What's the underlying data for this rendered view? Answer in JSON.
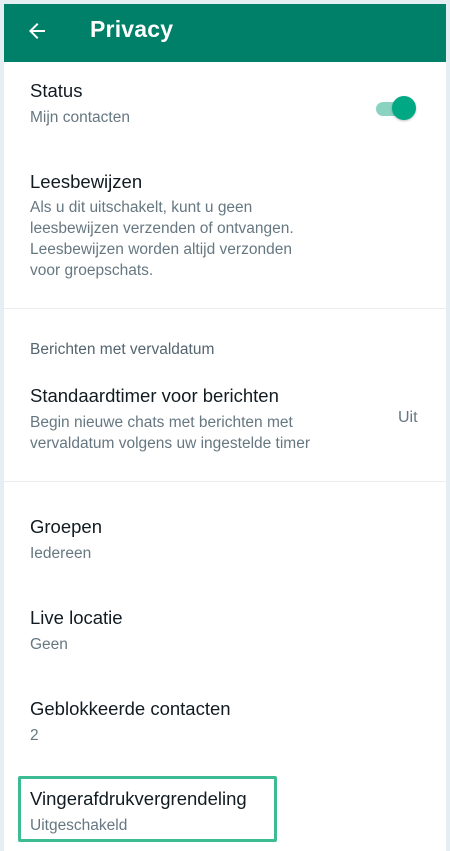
{
  "colors": {
    "header": "#008069",
    "accent": "#00a884",
    "highlight_border": "#3dbb93"
  },
  "header": {
    "title": "Privacy",
    "back_icon": "arrow-left-icon"
  },
  "status": {
    "title": "Status",
    "value": "Mijn contacten"
  },
  "read_receipts": {
    "title": "Leesbewijzen",
    "description_lines": [
      "Als u dit uitschakelt, kunt u geen",
      "leesbewijzen verzenden of ontvangen.",
      "Leesbewijzen worden altijd verzonden",
      "voor groepschats."
    ],
    "toggle_on": true
  },
  "disappearing": {
    "section_header": "Berichten met vervaldatum",
    "title": "Standaardtimer voor berichten",
    "description_lines": [
      "Begin nieuwe chats met berichten met",
      "vervaldatum volgens uw ingestelde timer"
    ],
    "value": "Uit"
  },
  "groups": {
    "title": "Groepen",
    "value": "Iedereen"
  },
  "live_location": {
    "title": "Live locatie",
    "value": "Geen"
  },
  "blocked": {
    "title": "Geblokkeerde contacten",
    "value": "2"
  },
  "fingerprint": {
    "title": "Vingerafdrukvergrendeling",
    "value": "Uitgeschakeld"
  }
}
